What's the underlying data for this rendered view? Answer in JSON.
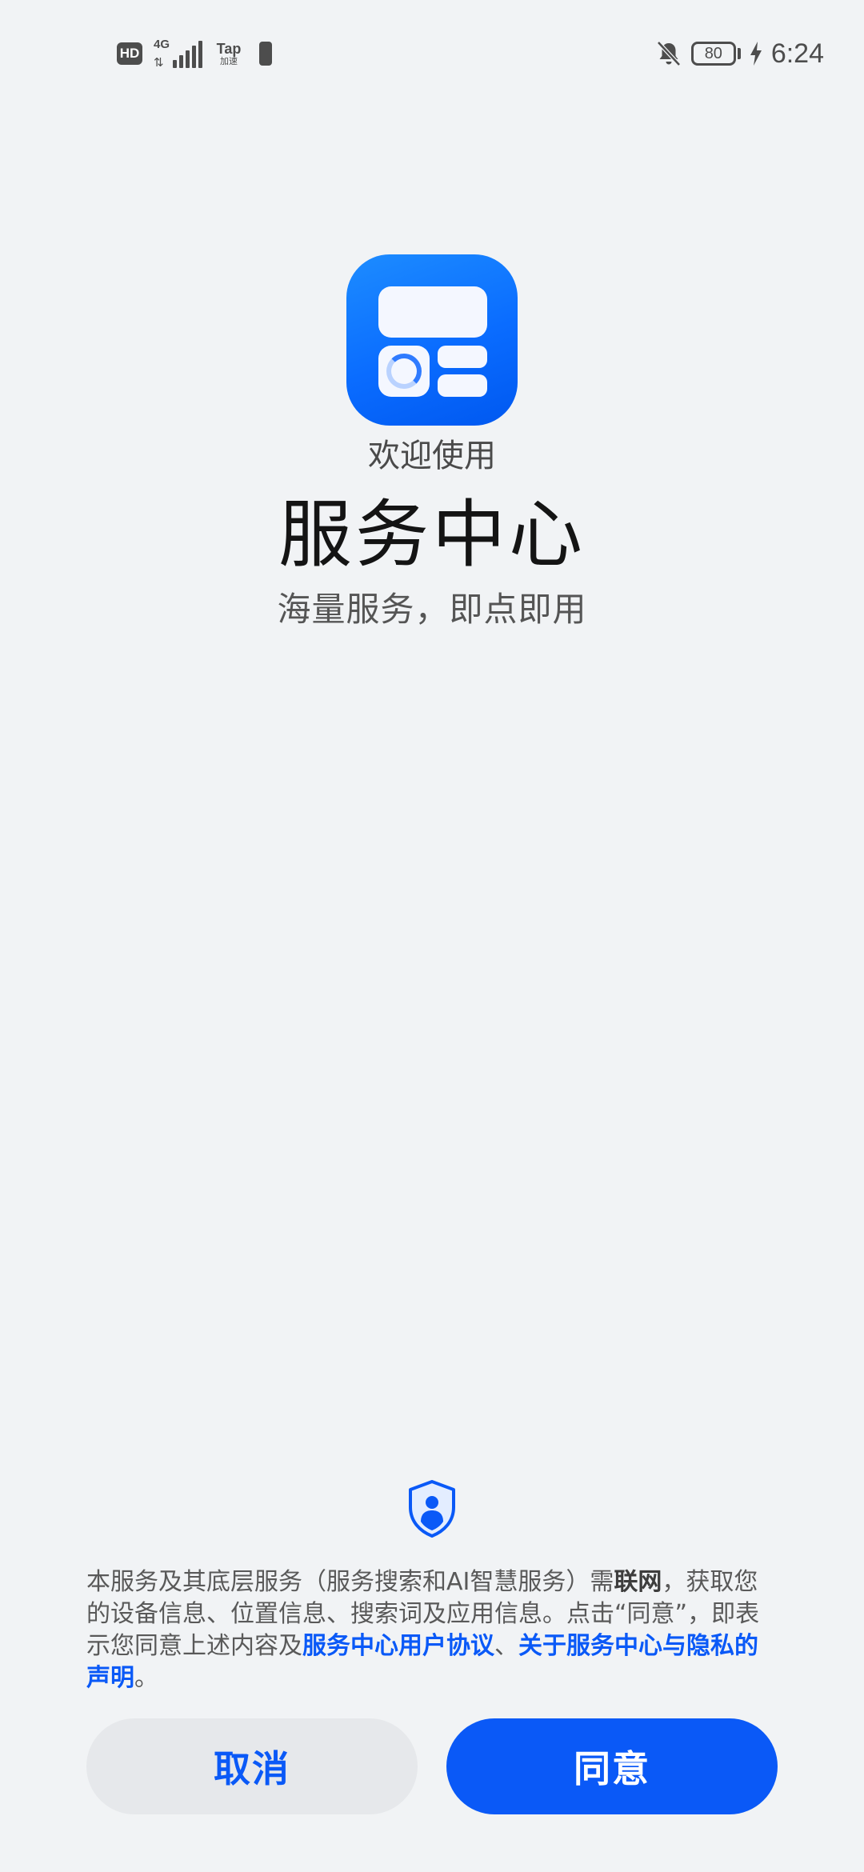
{
  "status_bar": {
    "hd_label": "HD",
    "network_label": "4G",
    "tap_label": "Tap",
    "tap_sub_label": "加速",
    "battery_level": "80",
    "time": "6:24",
    "icons": [
      "hd-icon",
      "signal-icon",
      "tap-accelerate-icon",
      "battery-small-icon",
      "bell-muted-icon",
      "battery-icon",
      "charging-bolt-icon"
    ]
  },
  "hero": {
    "app_icon": "service-center-app-icon",
    "welcome": "欢迎使用",
    "title": "服务中心",
    "subtitle": "海量服务，即点即用"
  },
  "privacy": {
    "icon": "shield-user-icon",
    "text_part1": "本服务及其底层服务（服务搜索和AI智慧服务）需",
    "text_bold": "联网",
    "text_part2": "，获取您的设备信息、位置信息、搜索词及应用信息。点击“同意”，即表示您同意上述内容及",
    "link_user_agreement": "服务中心用户协议",
    "separator": "、",
    "link_privacy": "关于服务中心与隐私的声明",
    "text_end": "。"
  },
  "buttons": {
    "cancel_label": "取消",
    "agree_label": "同意"
  },
  "colors": {
    "background": "#f1f3f5",
    "accent": "#0a59f7",
    "cancel_bg": "#e6e8eb"
  }
}
